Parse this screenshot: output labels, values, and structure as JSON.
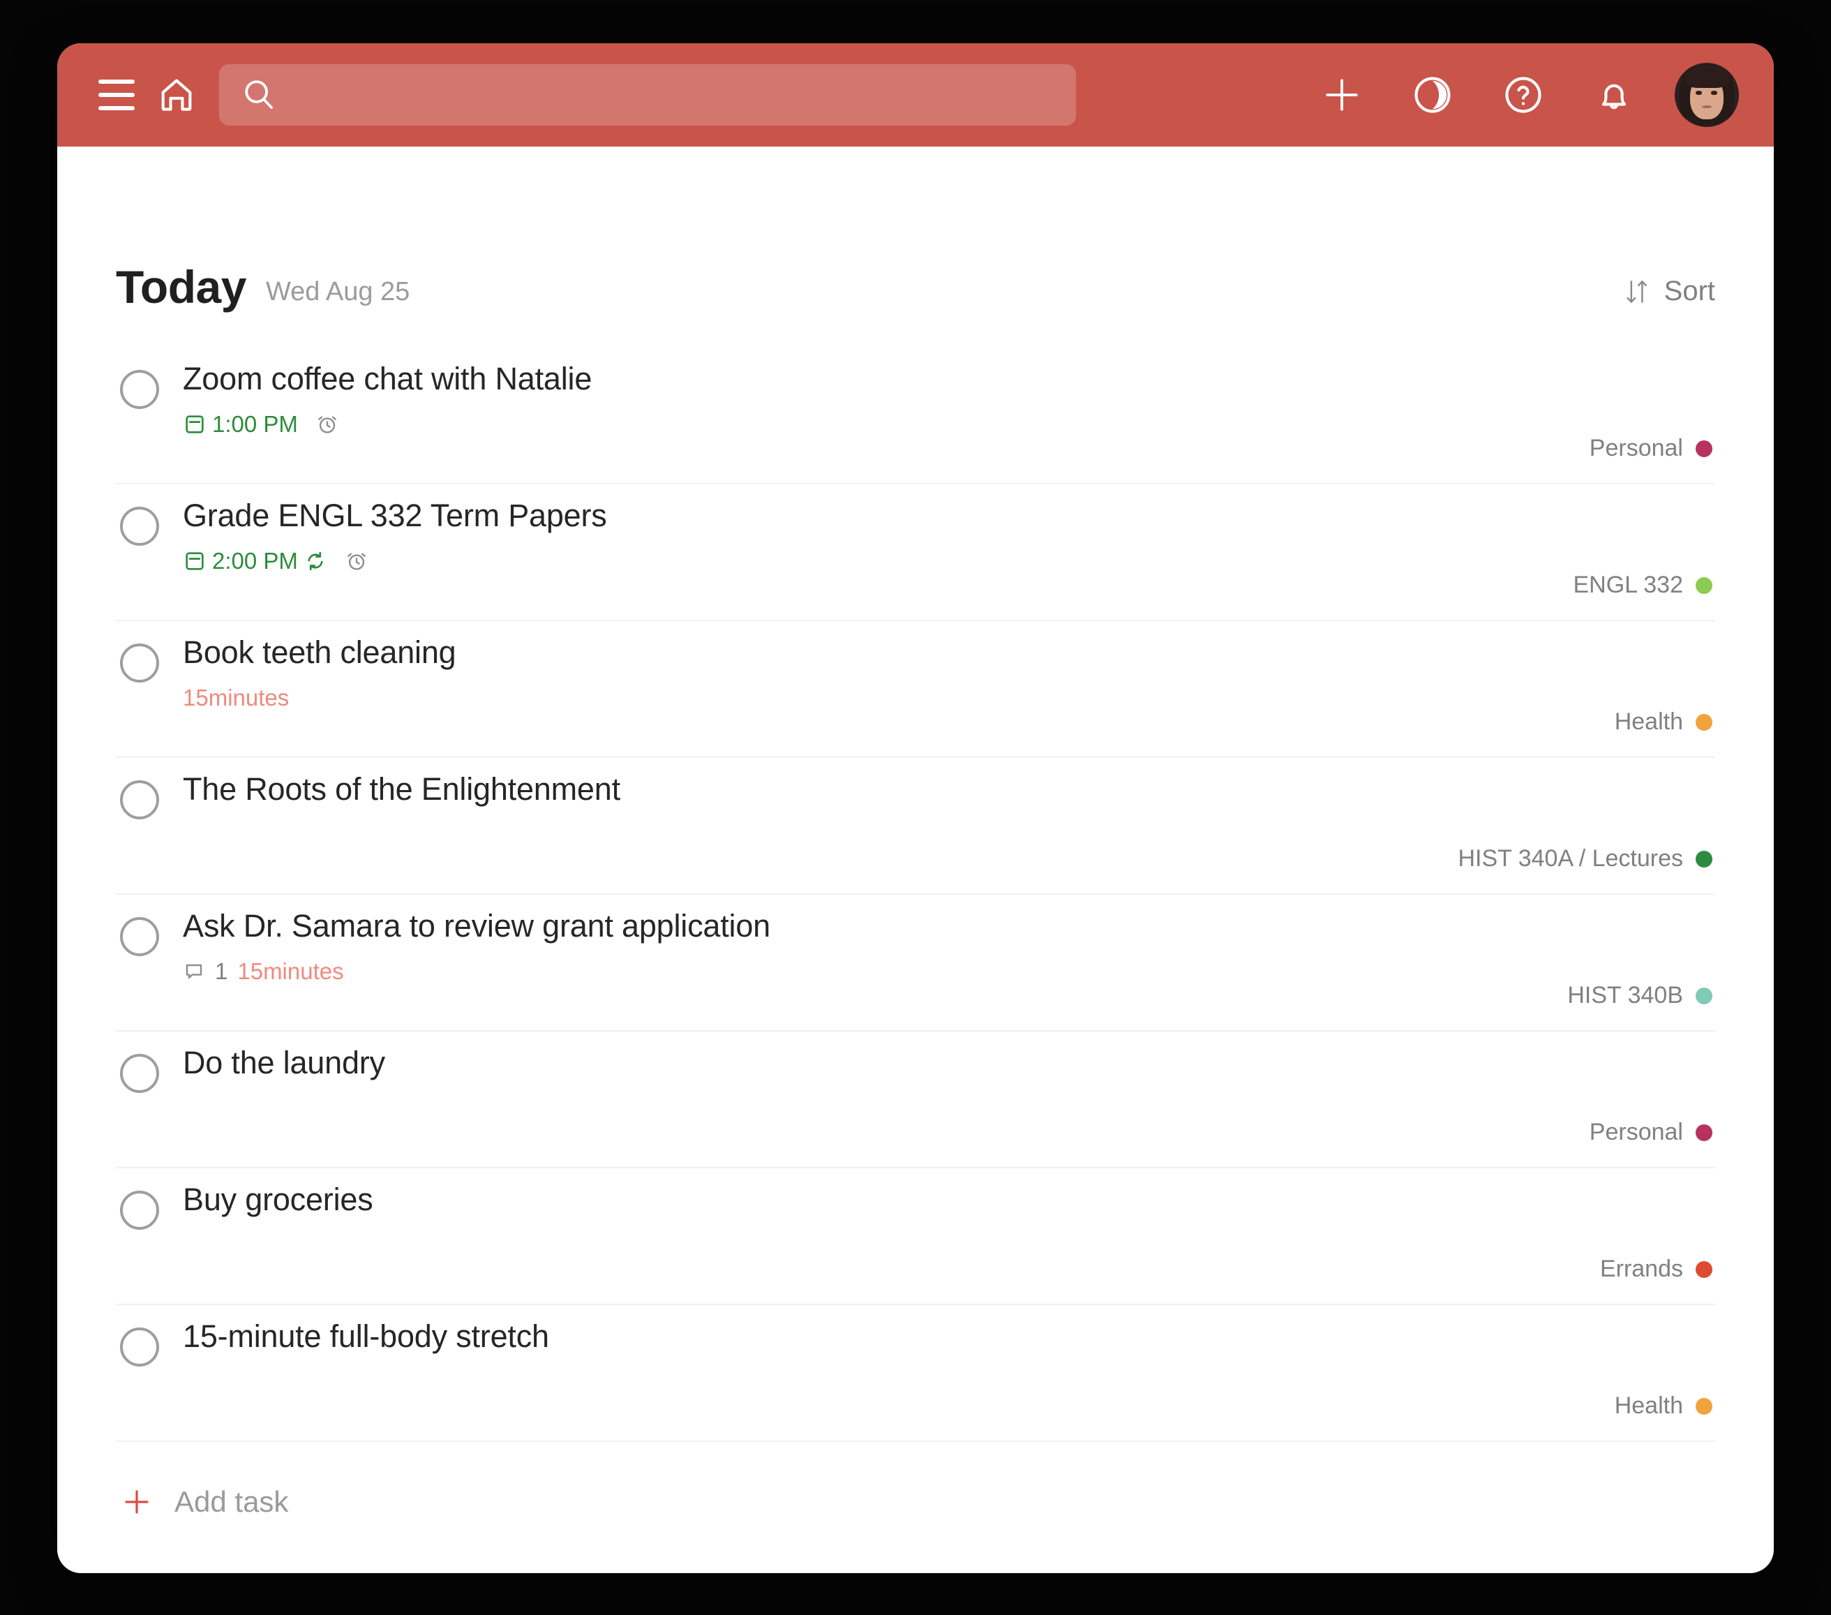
{
  "header": {
    "menu_icon": "hamburger-menu-icon",
    "home_icon": "home-icon",
    "search_icon": "search-icon",
    "search_value": "",
    "search_placeholder": "",
    "add_icon": "plus-icon",
    "productivity_icon": "productivity-moon-icon",
    "help_icon": "question-mark-icon",
    "notifications_icon": "bell-icon",
    "avatar_label": "user-avatar",
    "bar_color": "#c9544a",
    "search_bg": "#d47c70"
  },
  "page": {
    "title": "Today",
    "subtitle": "Wed Aug 25",
    "sort_label": "Sort",
    "sort_icon": "sort-arrows-icon"
  },
  "tasks": [
    {
      "title": "Zoom coffee chat with Natalie",
      "due": "1:00 PM",
      "due_color": "#2c8c3c",
      "has_calendar_icon": true,
      "has_recurring_icon": false,
      "has_reminder_icon": true,
      "duration": "",
      "comments": "",
      "project": "Personal",
      "project_color": "#b8325e"
    },
    {
      "title": "Grade ENGL 332 Term Papers",
      "due": "2:00 PM",
      "due_color": "#2c8c3c",
      "has_calendar_icon": true,
      "has_recurring_icon": true,
      "has_reminder_icon": true,
      "duration": "",
      "comments": "",
      "project": "ENGL 332",
      "project_color": "#8ecb52"
    },
    {
      "title": "Book teeth cleaning",
      "due": "",
      "due_color": "",
      "has_calendar_icon": false,
      "has_recurring_icon": false,
      "has_reminder_icon": false,
      "duration": "15minutes",
      "comments": "",
      "project": "Health",
      "project_color": "#f2a33c"
    },
    {
      "title": "The Roots of the Enlightenment",
      "due": "",
      "due_color": "",
      "has_calendar_icon": false,
      "has_recurring_icon": false,
      "has_reminder_icon": false,
      "duration": "",
      "comments": "",
      "project": "HIST 340A / Lectures",
      "project_color": "#2e8b42"
    },
    {
      "title": "Ask Dr. Samara to review grant application",
      "due": "",
      "due_color": "",
      "has_calendar_icon": false,
      "has_recurring_icon": false,
      "has_reminder_icon": false,
      "duration": "15minutes",
      "comments": "1",
      "project": "HIST 340B",
      "project_color": "#7fcbb6"
    },
    {
      "title": "Do the laundry",
      "due": "",
      "due_color": "",
      "has_calendar_icon": false,
      "has_recurring_icon": false,
      "has_reminder_icon": false,
      "duration": "",
      "comments": "",
      "project": "Personal",
      "project_color": "#b8325e"
    },
    {
      "title": "Buy groceries",
      "due": "",
      "due_color": "",
      "has_calendar_icon": false,
      "has_recurring_icon": false,
      "has_reminder_icon": false,
      "duration": "",
      "comments": "",
      "project": "Errands",
      "project_color": "#dd4b32"
    },
    {
      "title": "15-minute full-body stretch",
      "due": "",
      "due_color": "",
      "has_calendar_icon": false,
      "has_recurring_icon": false,
      "has_reminder_icon": false,
      "duration": "",
      "comments": "",
      "project": "Health",
      "project_color": "#f2a33c"
    }
  ],
  "add_task": {
    "label": "Add task",
    "icon": "plus-icon",
    "icon_color": "#db4c3f"
  }
}
